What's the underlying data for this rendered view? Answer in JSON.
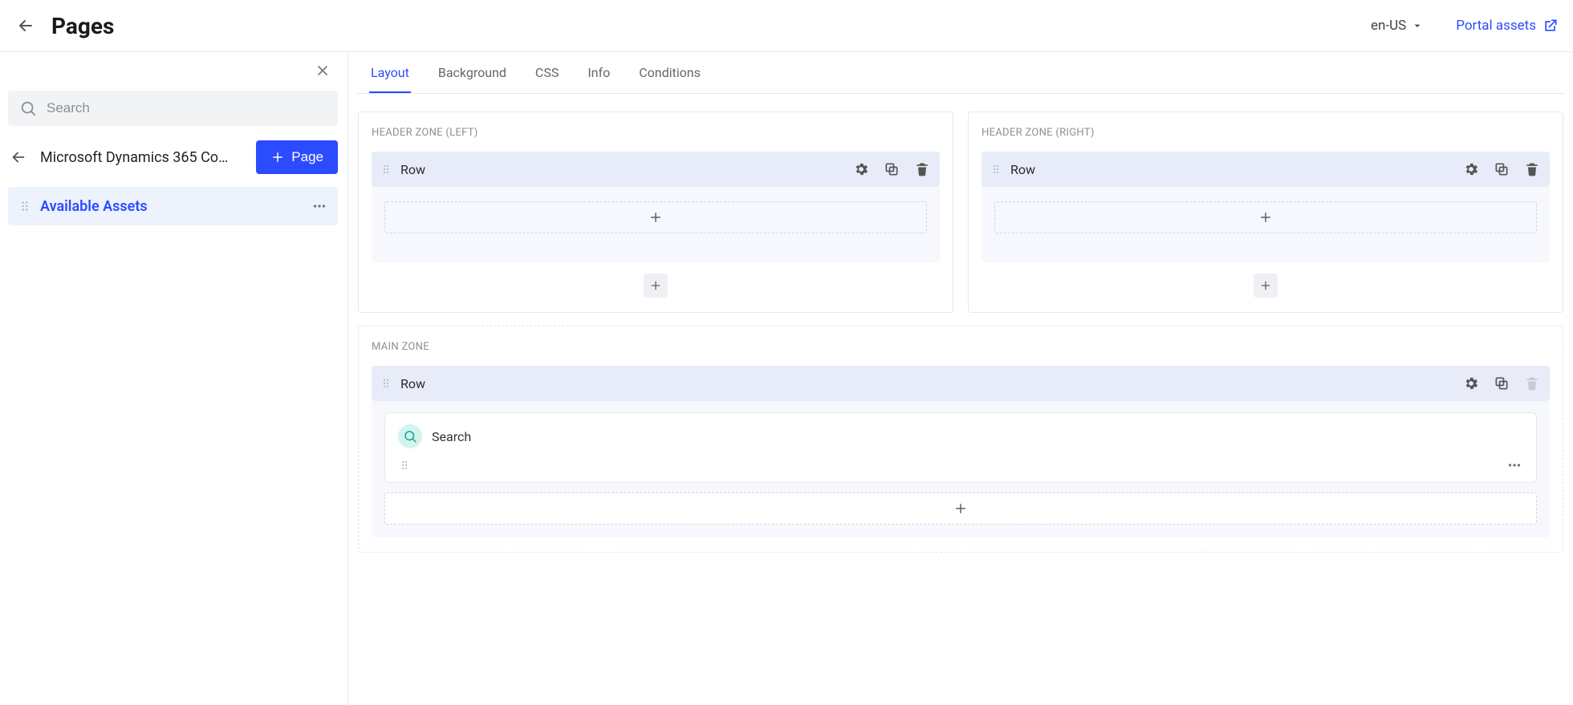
{
  "header": {
    "title": "Pages",
    "locale": "en-US",
    "portal_assets_label": "Portal assets"
  },
  "sidebar": {
    "search_placeholder": "Search",
    "breadcrumb": "Microsoft Dynamics 365 Co…",
    "add_page_label": "Page",
    "tree": {
      "active_node_label": "Available Assets"
    }
  },
  "tabs": [
    "Layout",
    "Background",
    "CSS",
    "Info",
    "Conditions"
  ],
  "active_tab_index": 0,
  "zones": {
    "header_left": {
      "title": "HEADER ZONE (LEFT)",
      "row_label": "Row"
    },
    "header_right": {
      "title": "HEADER ZONE (RIGHT)",
      "row_label": "Row"
    },
    "main": {
      "title": "MAIN ZONE",
      "row_label": "Row",
      "widgets": [
        {
          "icon": "search",
          "label": "Search"
        }
      ]
    }
  },
  "colors": {
    "accent": "#2b4bff",
    "row_bg": "#e7ecf8",
    "row_body_bg": "#f6f8fe",
    "widget_icon_bg": "#d4f3ee",
    "widget_icon_fg": "#0fa88f"
  }
}
